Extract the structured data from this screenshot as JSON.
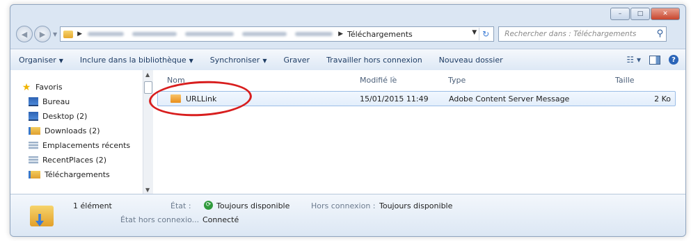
{
  "window": {
    "caption_buttons": {
      "minimize": "–",
      "maximize": "□",
      "close": "✕"
    }
  },
  "address": {
    "current_folder": "Téléchargements",
    "search_placeholder": "Rechercher dans : Téléchargements"
  },
  "toolbar": {
    "organize": "Organiser",
    "include_library": "Inclure dans la bibliothèque",
    "sync": "Synchroniser",
    "burn": "Graver",
    "work_offline": "Travailler hors connexion",
    "new_folder": "Nouveau dossier"
  },
  "nav": {
    "favorites_label": "Favoris",
    "items": [
      {
        "label": "Bureau",
        "icon": "desktop-icon"
      },
      {
        "label": "Desktop (2)",
        "icon": "desktop-icon"
      },
      {
        "label": "Downloads (2)",
        "icon": "downloads-folder-icon"
      },
      {
        "label": "Emplacements récents",
        "icon": "recent-places-icon"
      },
      {
        "label": "RecentPlaces (2)",
        "icon": "recent-places-icon"
      },
      {
        "label": "Téléchargements",
        "icon": "downloads-folder-icon"
      }
    ]
  },
  "columns": {
    "name": "Nom",
    "modified": "Modifié le",
    "type": "Type",
    "size": "Taille"
  },
  "files": [
    {
      "name": "URLLink",
      "modified": "15/01/2015 11:49",
      "type": "Adobe Content Server Message",
      "size": "2 Ko"
    }
  ],
  "details": {
    "count": "1 élément",
    "state_label": "État :",
    "state_value": "Toujours disponible",
    "offline_label": "Hors connexion :",
    "offline_value": "Toujours disponible",
    "offline_state_label": "État hors connexio...",
    "offline_state_value": "Connecté"
  },
  "colors": {
    "highlight_ring": "#d81e1e",
    "accent": "#2b65b8"
  }
}
